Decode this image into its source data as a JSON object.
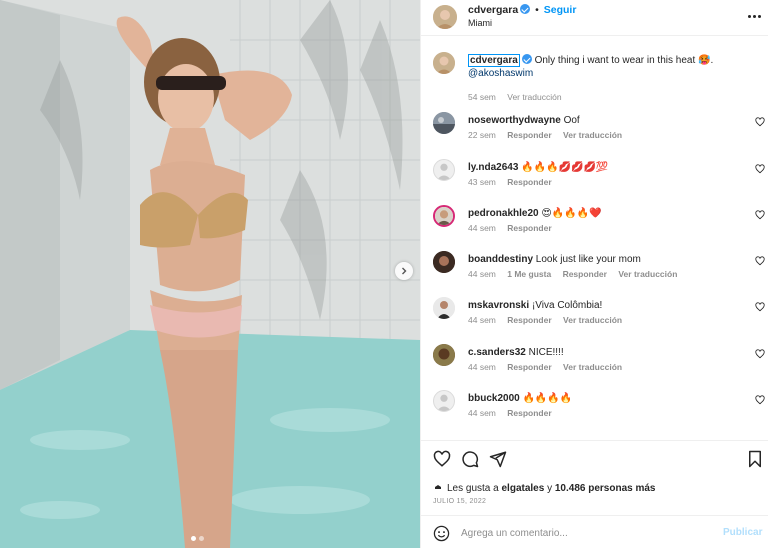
{
  "post": {
    "username": "cdvergara",
    "follow_label": "Seguir",
    "separator": "•",
    "location": "Miami"
  },
  "icons": {
    "verified": "verified-badge-icon",
    "more": "more-options-icon",
    "carousel_next": "chevron-right-icon",
    "heart": "heart-icon",
    "comment": "comment-icon",
    "share": "send-icon",
    "save": "bookmark-icon",
    "emoji": "emoji-smile-icon"
  },
  "caption": {
    "username": "cdvergara",
    "text": "Only thing i want to wear in this heat 🥵.",
    "mention": "@akoshaswim",
    "time": "54 sem",
    "translate": "Ver traducción"
  },
  "comments": [
    {
      "username": "noseworthydwayne",
      "text": "Oof",
      "time": "22 sem",
      "likes": "",
      "reply": "Responder",
      "translate": "Ver traducción"
    },
    {
      "username": "ly.nda2643",
      "text": "🔥🔥🔥💋💋💋💯",
      "time": "43 sem",
      "likes": "",
      "reply": "Responder",
      "translate": ""
    },
    {
      "username": "pedronakhle20",
      "text": "😍🔥🔥🔥❤️",
      "time": "44 sem",
      "likes": "",
      "reply": "Responder",
      "translate": ""
    },
    {
      "username": "boanddestiny",
      "text": "Look just like your mom",
      "time": "44 sem",
      "likes": "1 Me gusta",
      "reply": "Responder",
      "translate": "Ver traducción"
    },
    {
      "username": "mskavronski",
      "text": "¡Viva Colômbia!",
      "time": "44 sem",
      "likes": "",
      "reply": "Responder",
      "translate": "Ver traducción"
    },
    {
      "username": "c.sanders32",
      "text": "NICE!!!!",
      "time": "44 sem",
      "likes": "",
      "reply": "Responder",
      "translate": "Ver traducción"
    },
    {
      "username": "bbuck2000",
      "text": "🔥🔥🔥🔥",
      "time": "44 sem",
      "likes": "",
      "reply": "Responder",
      "translate": ""
    }
  ],
  "likes": {
    "prefix": "Les gusta a",
    "user": "elgatales",
    "connector": "y",
    "others": "10.486 personas más"
  },
  "date": "JULIO 15, 2022",
  "add_comment": {
    "placeholder": "Agrega un comentario...",
    "publish_label": "Publicar"
  },
  "colors": {
    "accent": "#0095f6",
    "mention": "#00376b",
    "muted": "#8e8e8e",
    "publish_disabled": "#b2dffc",
    "pool_water": "#8dcdc9"
  }
}
